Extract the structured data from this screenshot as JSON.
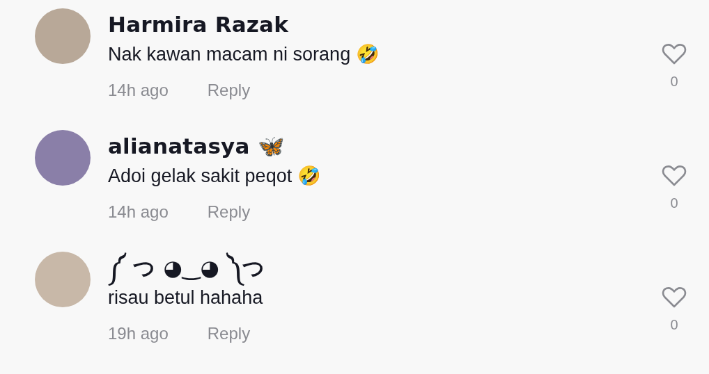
{
  "comments": [
    {
      "author": "Harmira Razak",
      "text": "Nak kawan macam ni sorang 🤣",
      "time": "14h ago",
      "reply": "Reply",
      "likes": "0",
      "liked": false
    },
    {
      "author": "alianatasya 🦋",
      "text": "Adoi gelak sakit peqot 🤣",
      "time": "14h ago",
      "reply": "Reply",
      "likes": "0",
      "liked": false
    },
    {
      "author": "༼ つ ◕‿◕ ༽つ",
      "text": "risau betul hahaha",
      "time": "19h ago",
      "reply": "Reply",
      "likes": "0",
      "liked": false
    }
  ]
}
